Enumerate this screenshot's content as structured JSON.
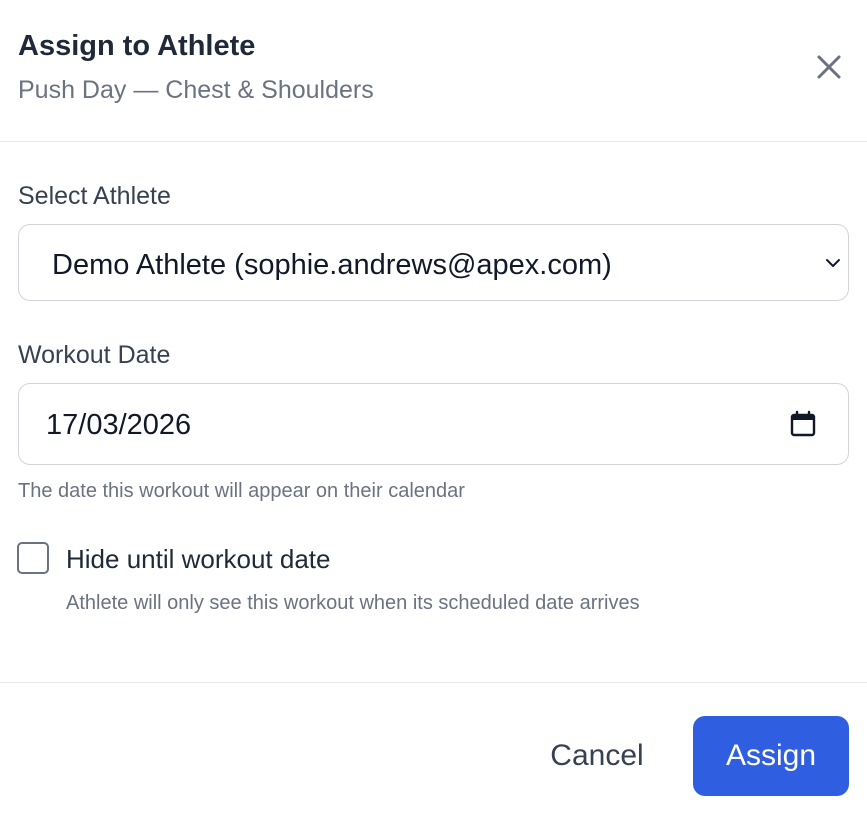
{
  "dialog": {
    "title": "Assign to Athlete",
    "subtitle": "Push Day — Chest & Shoulders",
    "close_icon": "close-icon"
  },
  "athlete_field": {
    "label": "Select Athlete",
    "selected": "Demo Athlete (sophie.andrews@apex.com)",
    "icon": "chevron-down-icon"
  },
  "date_field": {
    "label": "Workout Date",
    "value": "17/03/2026",
    "hint": "The date this workout will appear on their calendar",
    "icon": "calendar-icon"
  },
  "hide_option": {
    "label": "Hide until workout date",
    "hint": "Athlete will only see this workout when its scheduled date arrives",
    "checked": false
  },
  "actions": {
    "cancel_label": "Cancel",
    "assign_label": "Assign"
  },
  "colors": {
    "primary": "#2f5fe0",
    "border": "#d1d5db",
    "muted_text": "#6b7280",
    "text": "#1f2937"
  }
}
